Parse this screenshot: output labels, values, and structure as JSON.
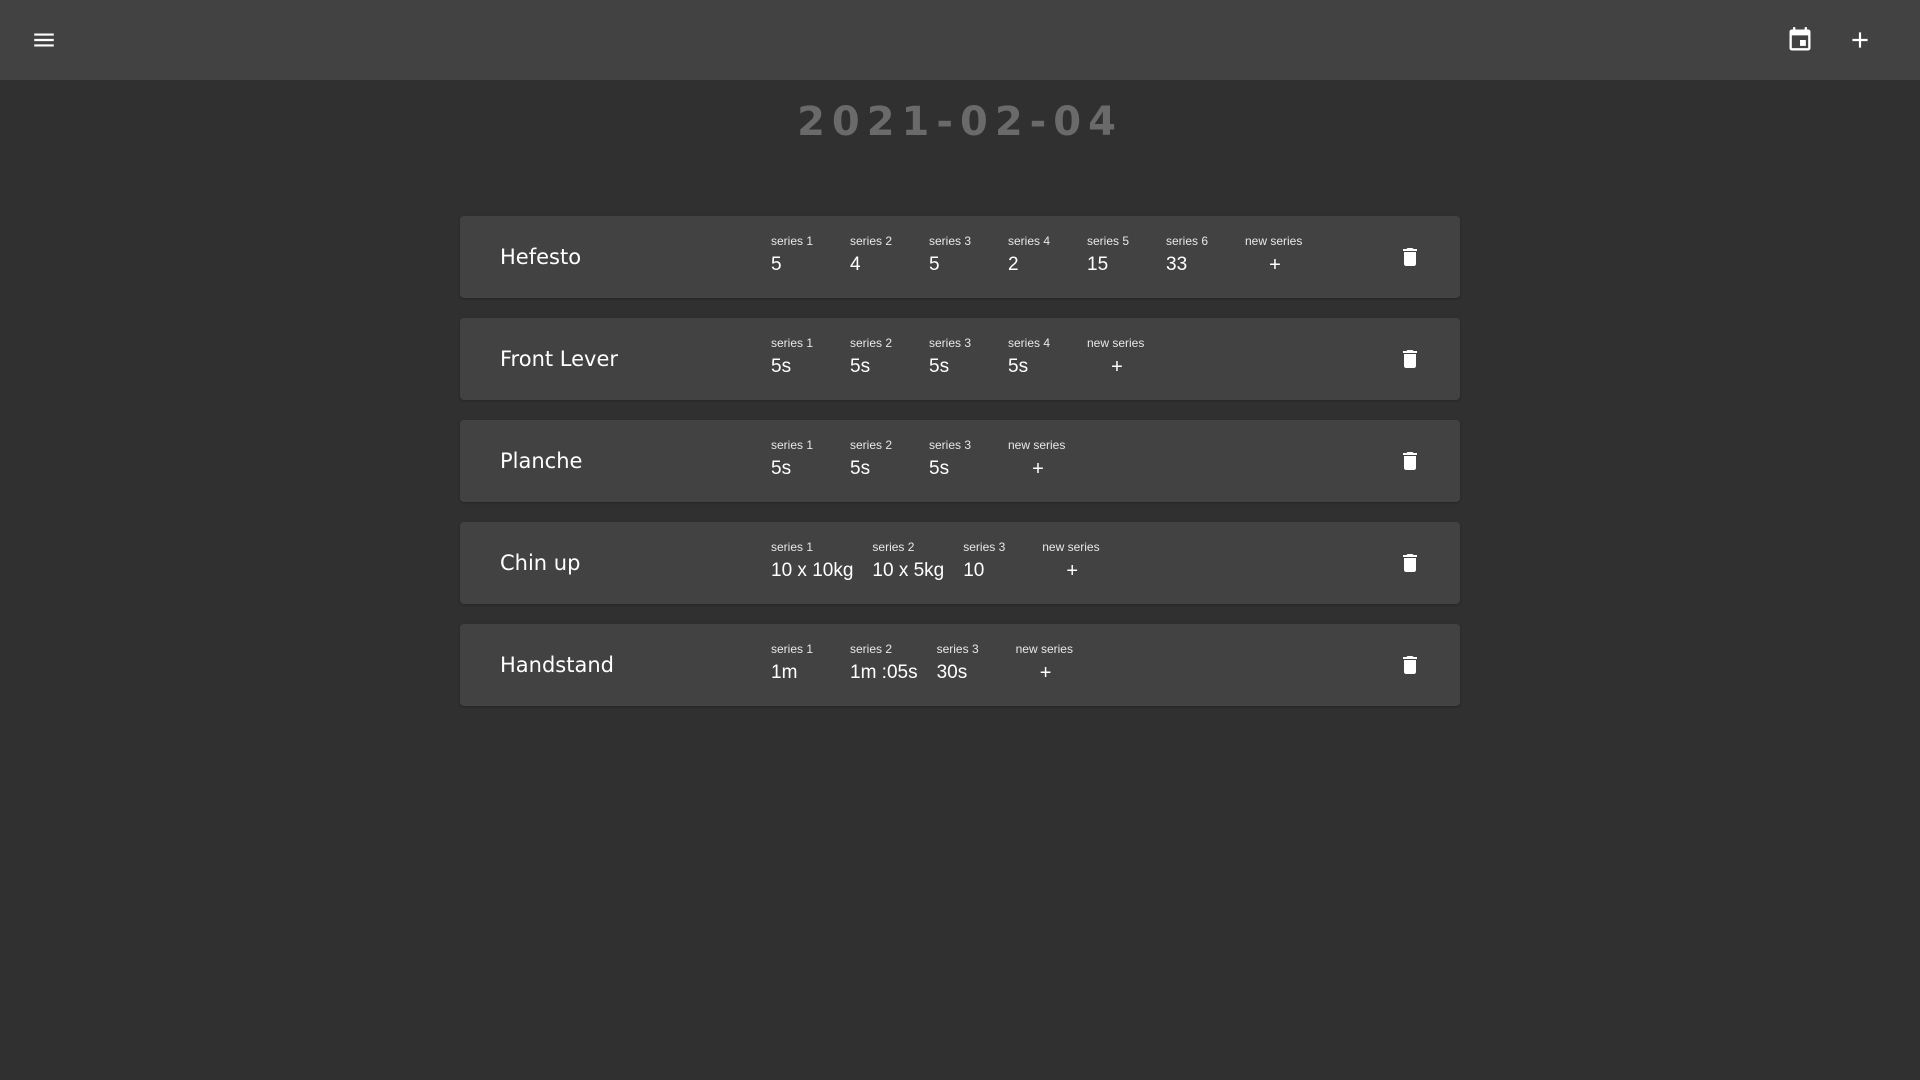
{
  "header": {
    "menu_icon": "menu-icon",
    "calendar_icon": "calendar-icon",
    "add_icon": "plus-icon"
  },
  "date": "2021-02-04",
  "colors": {
    "background": "#303030",
    "topbar": "#424242",
    "card": "#424242",
    "date_text": "#6a6a6a",
    "text": "#ffffff"
  },
  "exercises": [
    {
      "name": "Hefesto",
      "series": [
        {
          "label": "series 1",
          "value": "5"
        },
        {
          "label": "series 2",
          "value": "4"
        },
        {
          "label": "series 3",
          "value": "5"
        },
        {
          "label": "series 4",
          "value": "2"
        },
        {
          "label": "series 5",
          "value": "15"
        },
        {
          "label": "series 6",
          "value": "33"
        }
      ],
      "new_series_label": "new series",
      "new_series_value": "+"
    },
    {
      "name": "Front Lever",
      "series": [
        {
          "label": "series 1",
          "value": "5s"
        },
        {
          "label": "series 2",
          "value": "5s"
        },
        {
          "label": "series 3",
          "value": "5s"
        },
        {
          "label": "series 4",
          "value": "5s"
        }
      ],
      "new_series_label": "new series",
      "new_series_value": "+"
    },
    {
      "name": "Planche",
      "series": [
        {
          "label": "series 1",
          "value": "5s"
        },
        {
          "label": "series 2",
          "value": "5s"
        },
        {
          "label": "series 3",
          "value": "5s"
        }
      ],
      "new_series_label": "new series",
      "new_series_value": "+"
    },
    {
      "name": "Chin up",
      "series": [
        {
          "label": "series 1",
          "value": "10 x 10kg"
        },
        {
          "label": "series 2",
          "value": "10 x 5kg"
        },
        {
          "label": "series 3",
          "value": "10"
        }
      ],
      "new_series_label": "new series",
      "new_series_value": "+"
    },
    {
      "name": "Handstand",
      "series": [
        {
          "label": "series 1",
          "value": "1m"
        },
        {
          "label": "series 2",
          "value": "1m :05s"
        },
        {
          "label": "series 3",
          "value": "30s"
        }
      ],
      "new_series_label": "new series",
      "new_series_value": "+"
    }
  ]
}
